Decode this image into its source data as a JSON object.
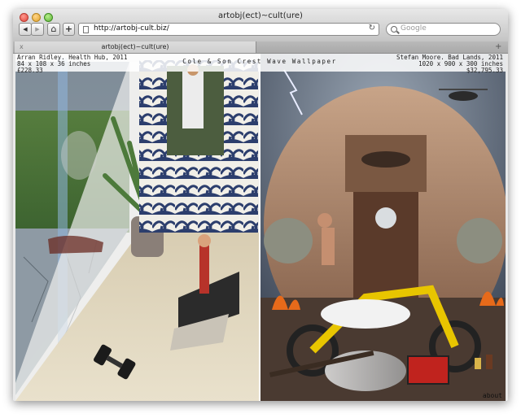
{
  "window": {
    "title": "artobj(ect)~cult(ure)"
  },
  "toolbar": {
    "back_symbol": "◀",
    "forward_symbol": "▶",
    "home_symbol": "⌂",
    "add_symbol": "+",
    "url": "http://artobj-cult.biz/",
    "search_placeholder": "Google",
    "reload_symbol": "↻"
  },
  "tabs": [
    {
      "label": "artobj(ect)~cult(ure)",
      "close_symbol": "x"
    }
  ],
  "newtab_symbol": "+",
  "page": {
    "left_caption": {
      "line1": "Arran Ridley. Health Hub, 2011",
      "line2": "84 x 108 x 36 inches",
      "line3": "£228.33"
    },
    "center_caption": "Cole & Son Crest Wave Wallpaper",
    "right_caption": {
      "line1": "Stefan Moore. Bad Lands, 2011",
      "line2": "1020 x 900 x 300 inches",
      "line3": "$32,795.33"
    },
    "about_label": "about"
  },
  "colors": {
    "accent_wave": "#2c3e6d",
    "gold": "#c79a1f",
    "sky": "#3f4d62"
  }
}
